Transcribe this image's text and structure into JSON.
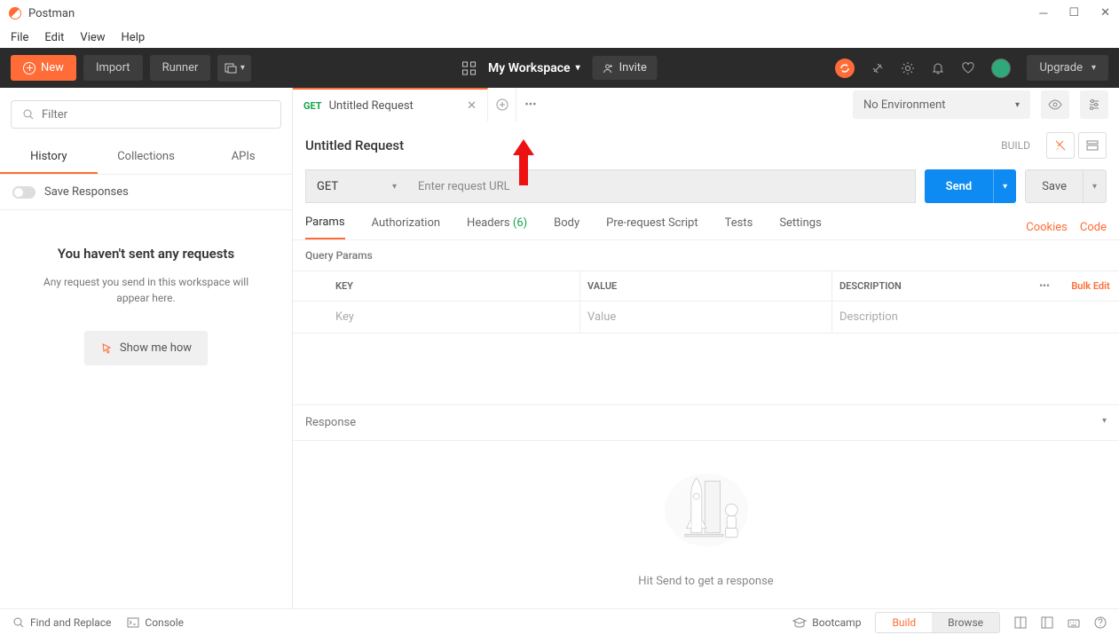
{
  "window": {
    "title": "Postman"
  },
  "menu": {
    "file": "File",
    "edit": "Edit",
    "view": "View",
    "help": "Help"
  },
  "toolbar": {
    "new": "New",
    "import": "Import",
    "runner": "Runner",
    "workspace": "My Workspace",
    "invite": "Invite",
    "upgrade": "Upgrade"
  },
  "sidebar": {
    "filter_placeholder": "Filter",
    "tabs": {
      "history": "History",
      "collections": "Collections",
      "apis": "APIs"
    },
    "save_responses": "Save Responses",
    "empty": {
      "title": "You haven't sent any requests",
      "subtitle": "Any request you send in this workspace will appear here.",
      "cta": "Show me how"
    }
  },
  "request": {
    "tab": {
      "method": "GET",
      "name": "Untitled Request"
    },
    "title": "Untitled Request",
    "build_label": "BUILD",
    "method": "GET",
    "url_placeholder": "Enter request URL",
    "send": "Send",
    "save": "Save",
    "subtabs": {
      "params": "Params",
      "auth": "Authorization",
      "headers": "Headers",
      "headers_count": "(6)",
      "body": "Body",
      "prerequest": "Pre-request Script",
      "tests": "Tests",
      "settings": "Settings"
    },
    "links": {
      "cookies": "Cookies",
      "code": "Code"
    },
    "query_params_label": "Query Params",
    "headers": {
      "key": "KEY",
      "value": "VALUE",
      "description": "DESCRIPTION",
      "bulk": "Bulk Edit"
    },
    "placeholders": {
      "key": "Key",
      "value": "Value",
      "description": "Description"
    },
    "env": {
      "none": "No Environment"
    }
  },
  "response": {
    "label": "Response",
    "empty": "Hit Send to get a response"
  },
  "footer": {
    "find": "Find and Replace",
    "console": "Console",
    "bootcamp": "Bootcamp",
    "build": "Build",
    "browse": "Browse"
  }
}
